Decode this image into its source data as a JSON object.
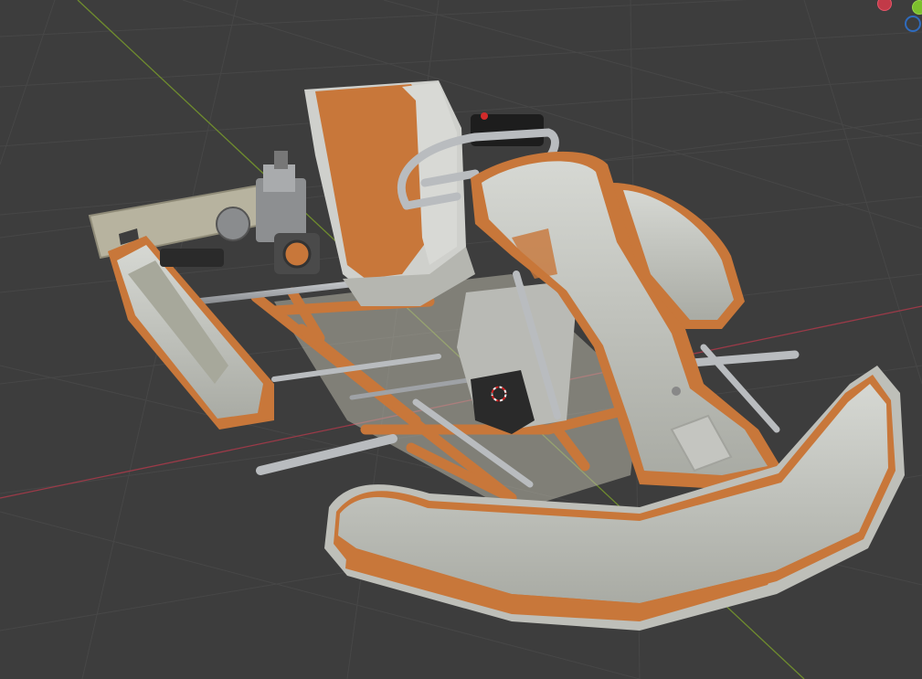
{
  "viewport": {
    "background_color": "#3d3d3d",
    "grid_color": "#474747",
    "x_axis_color": "#9b3a48",
    "y_axis_color": "#6f8c2e"
  },
  "model": {
    "body_color": "#c9cbc6",
    "trim_color": "#c8773a",
    "frame_color": "#c8773a",
    "metal_color": "#b9bcbf",
    "dark_color": "#2a2a2a"
  },
  "gizmo": {
    "x_icon": "x-axis-ball",
    "y_icon": "y-axis-ball",
    "z_icon": "z-axis-ring",
    "x_color": "#c23a48",
    "y_color": "#7cbf2d",
    "z_color": "#2f6bbd"
  },
  "cursor": {
    "icon": "3d-cursor-icon"
  }
}
